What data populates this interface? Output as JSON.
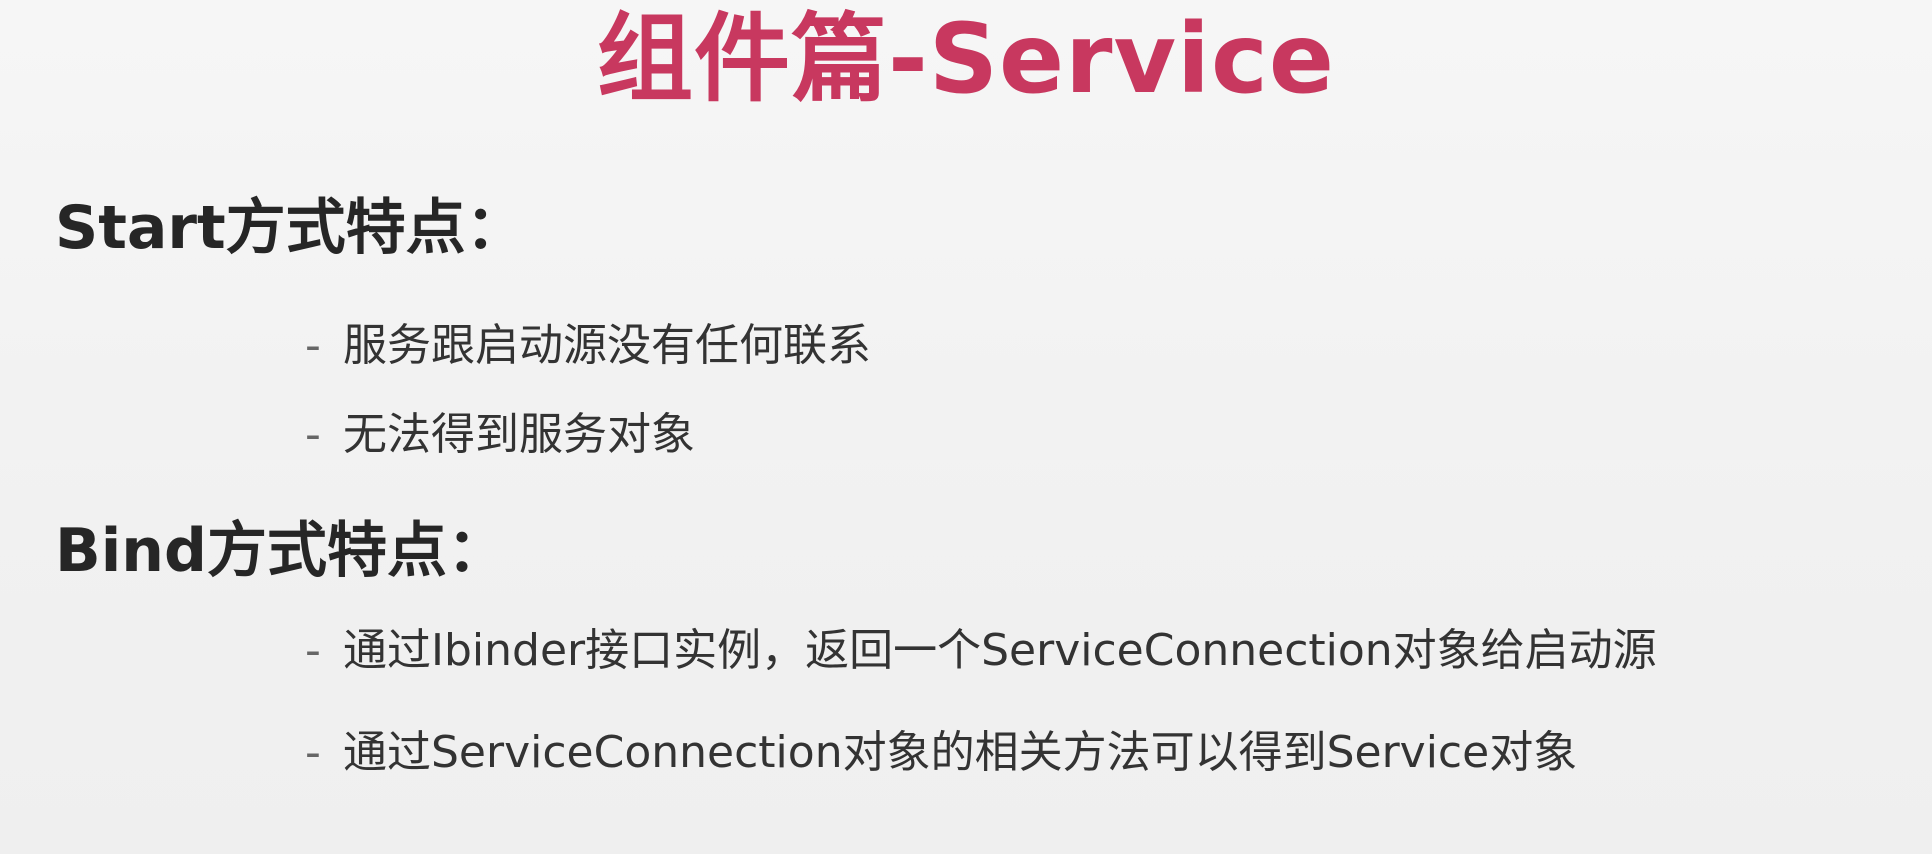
{
  "slide": {
    "title": "组件篇-Service",
    "sections": [
      {
        "heading": "Start方式特点：",
        "bullets": [
          "服务跟启动源没有任何联系",
          "无法得到服务对象"
        ]
      },
      {
        "heading": "Bind方式特点：",
        "bullets": [
          "通过Ibinder接口实例，返回一个ServiceConnection对象给启动源",
          "通过ServiceConnection对象的相关方法可以得到Service对象"
        ]
      }
    ],
    "bullet_marker": "-"
  },
  "colors": {
    "title": "#c8385f",
    "heading": "#262626",
    "text": "#333333",
    "background": "#f3f3f3"
  }
}
